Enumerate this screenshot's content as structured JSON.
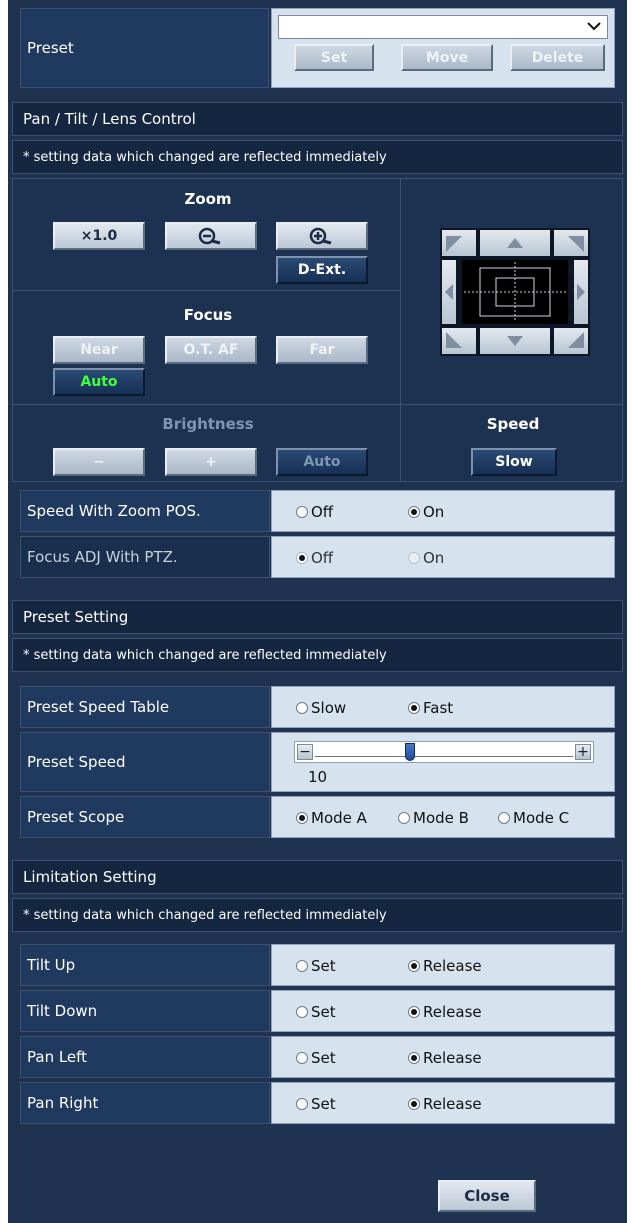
{
  "preset": {
    "label": "Preset",
    "select_value": "",
    "set_label": "Set",
    "move_label": "Move",
    "delete_label": "Delete"
  },
  "pan_tilt_lens": {
    "header": "Pan / Tilt / Lens Control",
    "note": "* setting data which changed are reflected immediately",
    "zoom": {
      "title": "Zoom",
      "x1_label": "×1.0",
      "dext_label": "D-Ext.",
      "zoom_out_icon": "zoom-out-icon",
      "zoom_in_icon": "zoom-in-icon"
    },
    "focus": {
      "title": "Focus",
      "near_label": "Near",
      "otaf_label": "O.T. AF",
      "far_label": "Far",
      "auto_label": "Auto"
    },
    "brightness": {
      "title": "Brightness",
      "minus_label": "−",
      "plus_label": "+",
      "auto_label": "Auto"
    },
    "speed": {
      "title": "Speed",
      "value_label": "Slow"
    },
    "speed_with_zoom": {
      "label": "Speed With Zoom POS.",
      "opt_off": "Off",
      "opt_on": "On",
      "selected": "On"
    },
    "focus_adj": {
      "label": "Focus ADJ With PTZ.",
      "opt_off": "Off",
      "opt_on": "On",
      "selected": "Off"
    }
  },
  "preset_setting": {
    "header": "Preset Setting",
    "note": "* setting data which changed are reflected immediately",
    "speed_table": {
      "label": "Preset Speed Table",
      "opt_slow": "Slow",
      "opt_fast": "Fast",
      "selected": "Fast"
    },
    "speed": {
      "label": "Preset Speed",
      "value": "10",
      "minus": "−",
      "plus": "+",
      "slider_fraction": 0.37
    },
    "scope": {
      "label": "Preset Scope",
      "opt_a": "Mode A",
      "opt_b": "Mode B",
      "opt_c": "Mode C",
      "selected": "Mode A"
    }
  },
  "limitation": {
    "header": "Limitation Setting",
    "note": "* setting data which changed are reflected immediately",
    "rows": [
      {
        "label": "Tilt Up",
        "opt_set": "Set",
        "opt_release": "Release",
        "selected": "Release"
      },
      {
        "label": "Tilt Down",
        "opt_set": "Set",
        "opt_release": "Release",
        "selected": "Release"
      },
      {
        "label": "Pan Left",
        "opt_set": "Set",
        "opt_release": "Release",
        "selected": "Release"
      },
      {
        "label": "Pan Right",
        "opt_set": "Set",
        "opt_release": "Release",
        "selected": "Release"
      }
    ]
  },
  "close_label": "Close"
}
